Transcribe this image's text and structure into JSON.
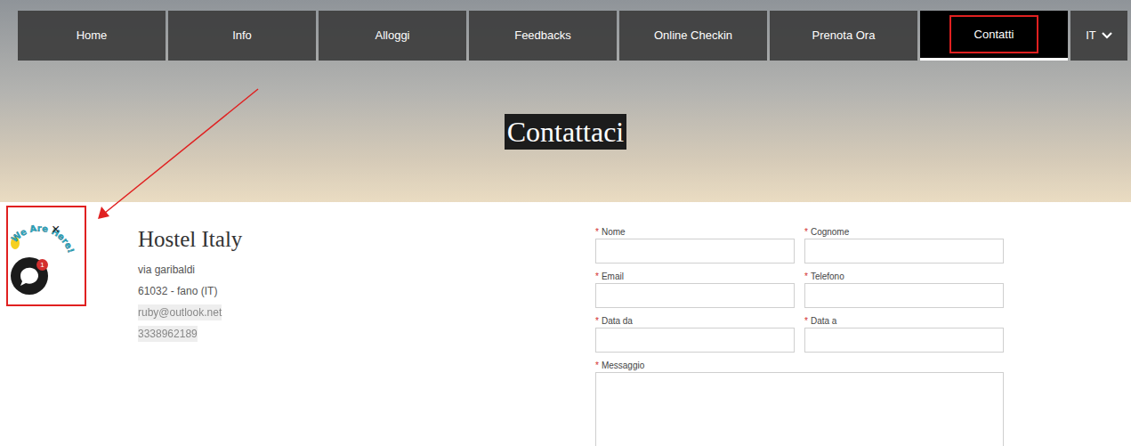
{
  "nav": {
    "items": [
      {
        "label": "Home",
        "selected": false
      },
      {
        "label": "Info",
        "selected": false
      },
      {
        "label": "Alloggi",
        "selected": false
      },
      {
        "label": "Feedbacks",
        "selected": false
      },
      {
        "label": "Online Checkin",
        "selected": false
      },
      {
        "label": "Prenota Ora",
        "selected": false
      },
      {
        "label": "Contatti",
        "selected": true
      }
    ],
    "language": "IT"
  },
  "hero": {
    "title": "Contattaci"
  },
  "contact": {
    "name": "Hostel Italy",
    "lines": [
      "via garibaldi",
      "61032 - fano (IT)"
    ],
    "blurred_lines": [
      "ruby@outlook.net",
      "3338962189"
    ]
  },
  "form": {
    "required_mark": "*",
    "fields": [
      {
        "label": "Nome",
        "kind": "input"
      },
      {
        "label": "Cognome",
        "kind": "input"
      },
      {
        "label": "Email",
        "kind": "input"
      },
      {
        "label": "Telefono",
        "kind": "input"
      },
      {
        "label": "Data da",
        "kind": "input"
      },
      {
        "label": "Data a",
        "kind": "input"
      },
      {
        "label": "Messaggio",
        "kind": "textarea"
      }
    ]
  },
  "chat_widget": {
    "caption": "We Are Here!",
    "close": "×",
    "badge": "1"
  }
}
